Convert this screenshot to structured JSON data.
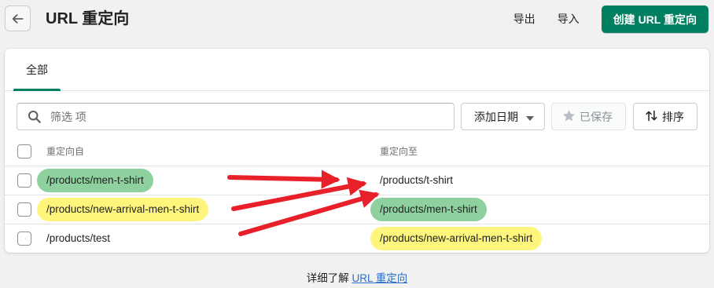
{
  "header": {
    "title": "URL 重定向",
    "export_label": "导出",
    "import_label": "导入",
    "create_label": "创建 URL 重定向"
  },
  "tabs": [
    {
      "label": "全部",
      "active": true
    }
  ],
  "filters": {
    "search_placeholder": "筛选 项",
    "date_label": "添加日期",
    "saved_label": "已保存",
    "sort_label": "排序"
  },
  "table": {
    "columns": [
      "重定向自",
      "重定向至"
    ],
    "rows": [
      {
        "from": "/products/men-t-shirt",
        "from_highlight": "green",
        "to": "/products/t-shirt",
        "to_highlight": "none"
      },
      {
        "from": "/products/new-arrival-men-t-shirt",
        "from_highlight": "yellow",
        "to": "/products/men-t-shirt",
        "to_highlight": "green"
      },
      {
        "from": "/products/test",
        "from_highlight": "none",
        "to": "/products/new-arrival-men-t-shirt",
        "to_highlight": "yellow"
      }
    ]
  },
  "footer": {
    "text": "详细了解",
    "link": "URL 重定向"
  },
  "colors": {
    "primary": "#008060",
    "highlight_green": "#8fd19e",
    "highlight_yellow": "#fdf57c",
    "annotation_arrow": "#e8202a",
    "link": "#2c6ecb"
  },
  "icons": {
    "back": "arrow-left-icon",
    "search": "search-icon",
    "date_caret": "caret-down-icon",
    "saved": "star-icon",
    "sort": "sort-icon"
  }
}
